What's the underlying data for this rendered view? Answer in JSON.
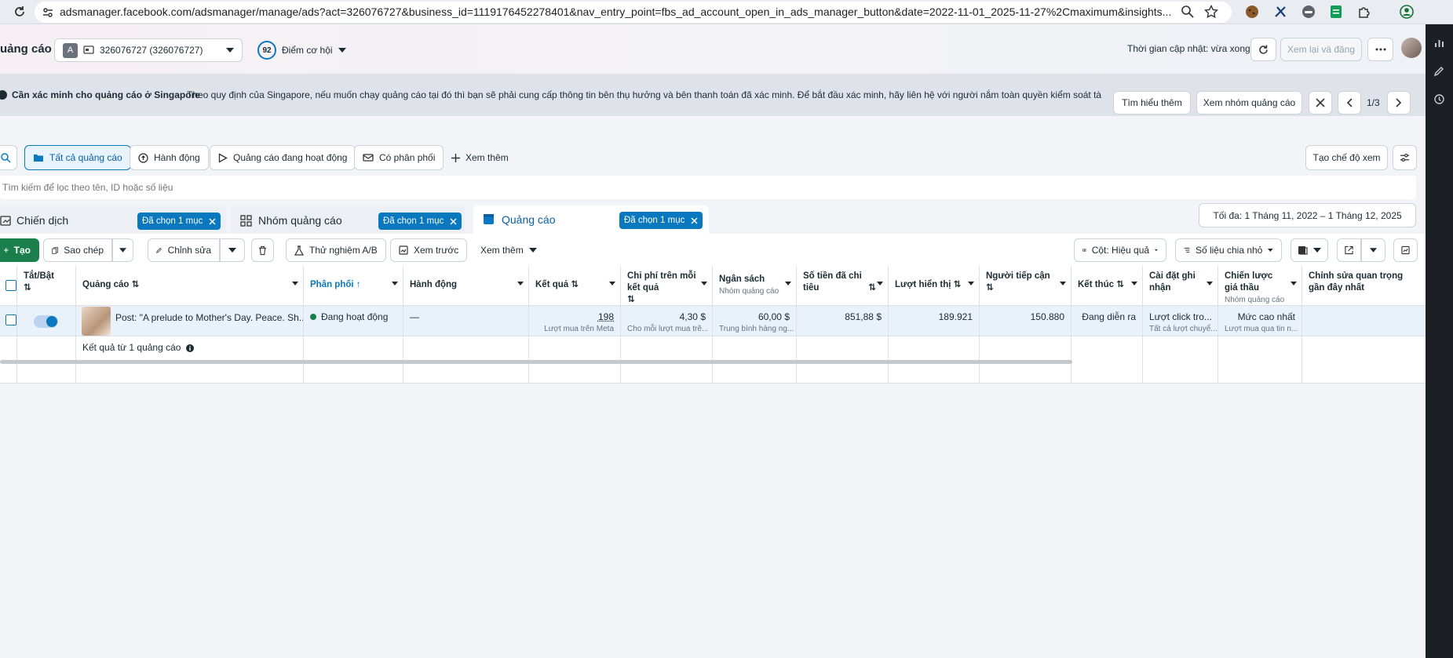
{
  "browser": {
    "url": "adsmanager.facebook.com/adsmanager/manage/ads?act=326076727&business_id=1119176452278401&nav_entry_point=fbs_ad_account_open_in_ads_manager_button&date=2022-11-01_2025-11-27%2Cmaximum&insights..."
  },
  "header": {
    "page_title": "uảng cáo",
    "account_letter": "A",
    "account_label": "326076727 (326076727)",
    "score": "92",
    "score_label": "Điểm cơ hội",
    "update_text": "Thời gian cập nhật: vừa xong",
    "review_publish": "Xem lại và đăng"
  },
  "notice": {
    "title": "Cần xác minh cho quảng cáo ở Singapore",
    "body": "Theo quy định của Singapore, nếu muốn chạy quảng cáo tại đó thì bạn sẽ phải cung cấp thông tin bên thụ hưởng và bên thanh toán đã xác minh. Để bắt đầu xác minh, hãy liên hệ với người nắm toàn quyền kiểm soát tài khoản quản...",
    "learn_more": "Tìm hiểu thêm",
    "view_adsets": "Xem nhóm quảng cáo",
    "pager": "1/3"
  },
  "filters": {
    "all_ads": "Tất cả quảng cáo",
    "actions": "Hành động",
    "active_ads": "Quảng cáo đang hoạt động",
    "delivering": "Có phân phối",
    "see_more": "Xem thêm",
    "create_view": "Tạo chế độ xem"
  },
  "search": {
    "placeholder": "Tìm kiếm để lọc theo tên, ID hoặc số liệu"
  },
  "tabs": {
    "campaigns": "Chiến dịch",
    "campaigns_chip": "Đã chọn 1 mục",
    "adsets": "Nhóm quảng cáo",
    "adsets_chip": "Đã chọn 1 mục",
    "ads": "Quảng cáo",
    "ads_chip": "Đã chọn 1 mục",
    "date_range": "Tối đa: 1 Tháng 11, 2022 – 1 Tháng 12, 2025"
  },
  "toolbar": {
    "create": "Tạo",
    "duplicate": "Sao chép",
    "edit": "Chỉnh sửa",
    "ab_test": "Thử nghiệm A/B",
    "preview": "Xem trước",
    "more": "Xem thêm",
    "columns": "Cột: Hiệu quả",
    "breakdown": "Số liệu chia nhỏ"
  },
  "table": {
    "headers": {
      "toggle": "Tắt/Bật",
      "ad": "Quảng cáo",
      "delivery": "Phân phối",
      "actions": "Hành động",
      "results": "Kết quả",
      "cost_per_result": "Chi phí trên mỗi kết quả",
      "budget": "Ngân sách",
      "budget_sub": "Nhóm quảng cáo",
      "amount_spent": "Số tiền đã chi tiêu",
      "impressions": "Lượt hiển thị",
      "reach": "Người tiếp cận",
      "ends": "Kết thúc",
      "attribution": "Cài đặt ghi nhận",
      "bid_strategy": "Chiến lược giá thầu",
      "bid_strategy_sub": "Nhóm quảng cáo",
      "last_edit": "Chỉnh sửa quan trọng gần đây nhất"
    },
    "row": {
      "ad_name": "Post: \"A prelude to Mother's Day. Peace. Sh...",
      "delivery": "Đang hoạt động",
      "actions": "—",
      "results": "198",
      "results_sub": "Lượt mua trên Meta",
      "cost_per_result": "4,30 $",
      "cost_per_result_sub": "Cho mỗi lượt mua trê...",
      "budget": "60,00 $",
      "budget_sub": "Trung bình hàng ng...",
      "amount_spent": "851,88 $",
      "impressions": "189.921",
      "reach": "150.880",
      "ends": "Đang diễn ra",
      "attribution": "Lượt click tro...",
      "attribution_sub": "Tất cả lượt chuyể...",
      "bid_strategy": "Mức cao nhất",
      "bid_strategy_sub": "Lượt mua qua tin n..."
    },
    "footer": "Kết quả từ 1 quảng cáo"
  },
  "colors": {
    "accent": "#0a78be",
    "create_green": "#1a7f4b",
    "active_dot": "#1a7f4b"
  }
}
